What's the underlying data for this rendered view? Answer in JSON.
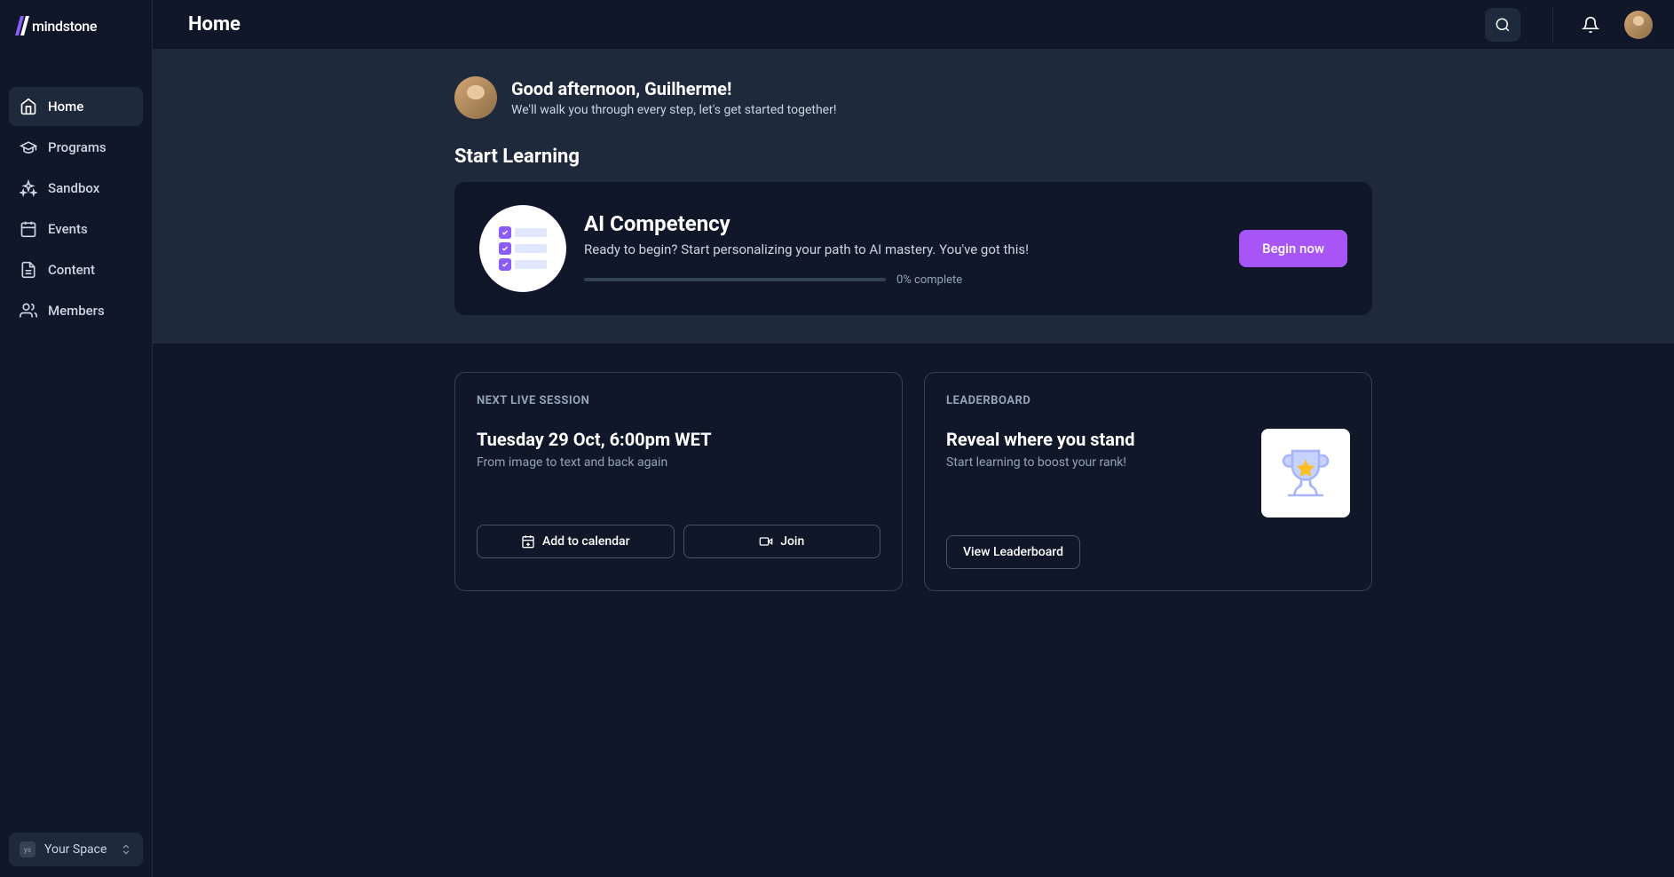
{
  "brand": {
    "name": "mindstone"
  },
  "sidebar": {
    "items": [
      {
        "label": "Home",
        "active": true
      },
      {
        "label": "Programs",
        "active": false
      },
      {
        "label": "Sandbox",
        "active": false
      },
      {
        "label": "Events",
        "active": false
      },
      {
        "label": "Content",
        "active": false
      },
      {
        "label": "Members",
        "active": false
      }
    ],
    "space": {
      "badge": "ys",
      "label": "Your Space"
    }
  },
  "header": {
    "title": "Home"
  },
  "greeting": {
    "title": "Good afternoon, Guilherme!",
    "subtitle": "We'll walk you through every step, let's get started together!"
  },
  "hero": {
    "section_title": "Start Learning",
    "card": {
      "title": "AI Competency",
      "description": "Ready to begin? Start personalizing your path to AI mastery. You've got this!",
      "progress_percent": 0,
      "progress_label": "0% complete",
      "cta": "Begin now"
    }
  },
  "session": {
    "label": "NEXT LIVE SESSION",
    "title": "Tuesday 29 Oct, 6:00pm WET",
    "description": "From image to text and back again",
    "add_calendar": "Add to calendar",
    "join": "Join"
  },
  "leaderboard": {
    "label": "LEADERBOARD",
    "title": "Reveal where you stand",
    "description": "Start learning to boost your rank!",
    "view": "View Leaderboard"
  }
}
